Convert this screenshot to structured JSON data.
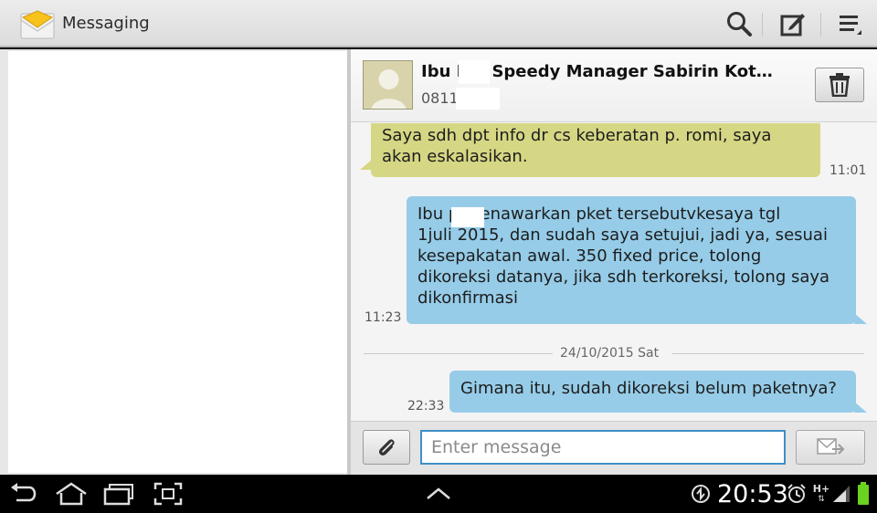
{
  "app": {
    "title": "Messaging",
    "icon": "envelope-icon"
  },
  "actionbar": {
    "icons": [
      "search-icon",
      "compose-icon",
      "menu-icon"
    ]
  },
  "conversation": {
    "contact_name": "Ibu F     K Speedy Manager Sabirin Kot…",
    "contact_number": "0811        34",
    "avatar_icon": "person-silhouette-icon",
    "delete_icon": "trash-icon"
  },
  "messages": [
    {
      "direction": "in",
      "lines": [
        "Saya sdh dpt info dr cs keberatan p. romi, saya",
        "akan eskalasikan."
      ],
      "time": "11:01"
    },
    {
      "direction": "out",
      "lines": [
        "Ibu p      menawarkan pket tersebutvkesaya tgl",
        "1juli 2015, dan sudah saya setujui, jadi ya, sesuai",
        "kesepakatan awal. 350 fixed price, tolong",
        "dikoreksi datanya, jika sdh terkoreksi, tolong saya",
        "dikonfirmasi"
      ],
      "time": "11:23"
    },
    {
      "direction": "out",
      "lines": [
        "Gimana itu, sudah dikoreksi belum paketnya?"
      ],
      "time": "22:33"
    }
  ],
  "date_separator": "24/10/2015 Sat",
  "compose": {
    "placeholder": "Enter message",
    "value": "",
    "attach_icon": "paperclip-icon",
    "send_icon": "send-icon"
  },
  "statusbar": {
    "clock": "20:53",
    "nav_icons": [
      "back-icon",
      "home-icon",
      "recent-apps-icon",
      "screenshot-icon",
      "up-arrow-icon"
    ],
    "status_icons": [
      "sync-icon",
      "alarm-icon",
      "hplus-signal-icon",
      "signal-bars-icon",
      "battery-icon"
    ],
    "network_label": "H+"
  },
  "colors": {
    "incoming_bubble": "#d6d784",
    "outgoing_bubble": "#96cce8",
    "input_border": "#3f8fc6"
  }
}
